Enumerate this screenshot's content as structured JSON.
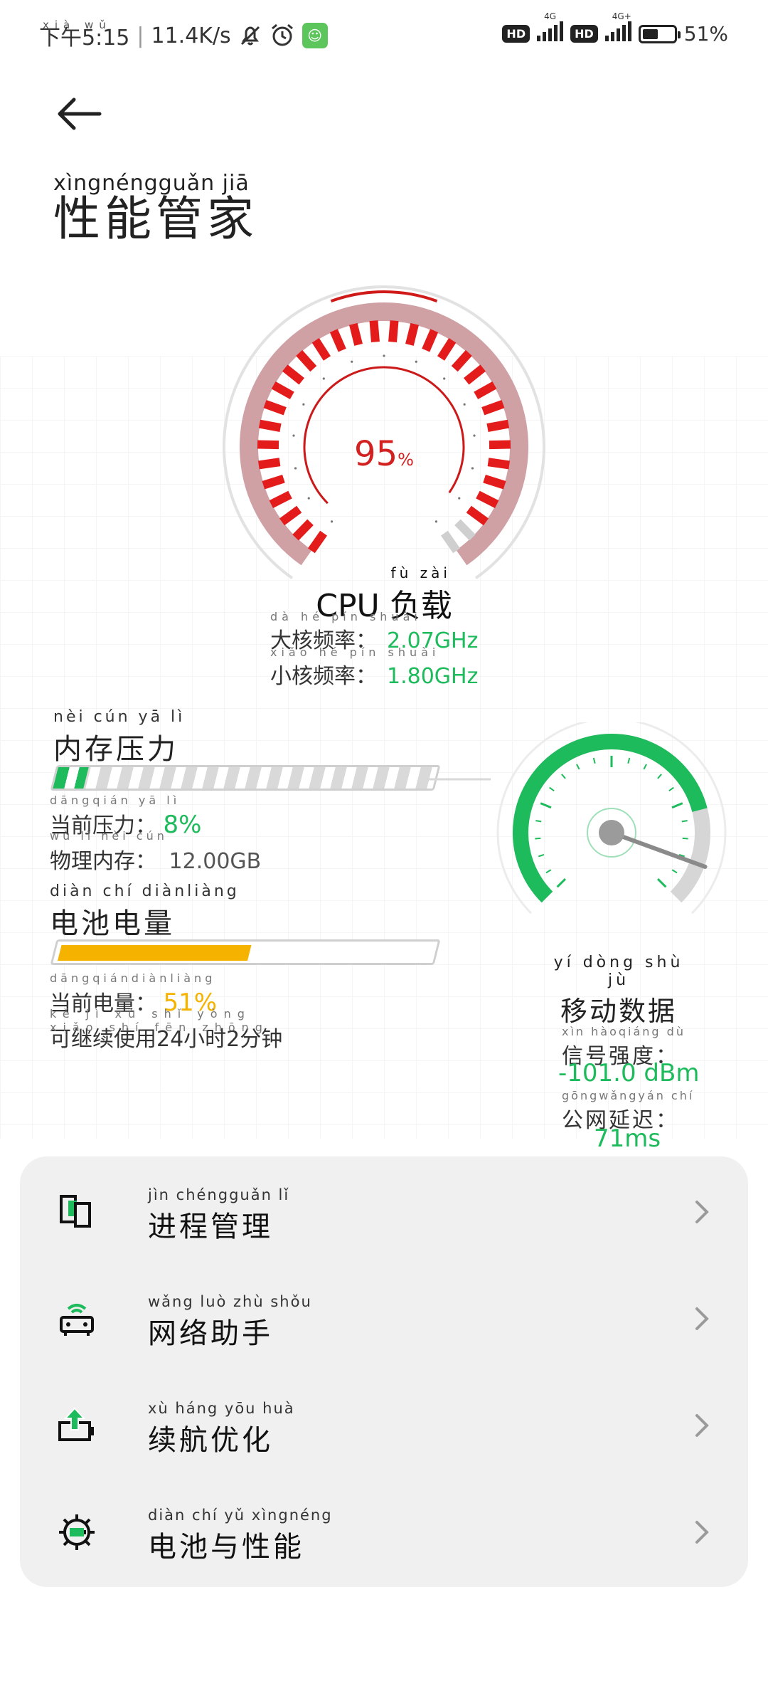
{
  "status_bar": {
    "time_pinyin": "xià wǔ",
    "time": "下午5:15",
    "speed": "11.4K/s",
    "network_1": "4G",
    "network_2": "4G+",
    "hd": "HD",
    "battery_percent": "51%",
    "battery_level": 0.51,
    "app_badge_icon": "cat-app-icon"
  },
  "header": {
    "back_icon": "arrow-left-icon",
    "title_pinyin": "xìngnéngguǎn jiā",
    "title": "性能管家"
  },
  "cpu": {
    "value": "95",
    "unit": "%",
    "load_fraction": 0.95,
    "label_prefix": "CPU",
    "label_pinyin": "fù zài",
    "label_suffix": "负载",
    "big_core_pinyin": "dà hé pín shuài",
    "big_core_label": "大核频率：",
    "big_core_value": "2.07GHz",
    "small_core_pinyin": "xiǎo hé pín shuài",
    "small_core_label": "小核频率：",
    "small_core_value": "1.80GHz"
  },
  "memory": {
    "title_pinyin": "nèi cún yā lì",
    "title": "内存压力",
    "pressure_fraction": 0.08,
    "current_pinyin": "dāngqián yā lì",
    "current_label": "当前压力：",
    "current_value": "8%",
    "physical_pinyin": "wù lǐ nèi cún",
    "physical_label": "物理内存：",
    "physical_value": "12.00GB"
  },
  "battery": {
    "title_pinyin": "diàn chí diànliàng",
    "title": "电池电量",
    "level_fraction": 0.51,
    "current_pinyin": "dāngqiándiànliàng",
    "current_label": "当前电量：",
    "current_value": "51%",
    "remaining_pinyin": "kě jì xù shǐ yòng xiǎo shí fēn zhōng",
    "remaining_text": "可继续使用24小时2分钟"
  },
  "mobile_data": {
    "title_pinyin": "yí dòng shù jù",
    "title": "移动数据",
    "signal_pinyin": "xìn hàoqiáng dù",
    "signal_label": "信号强度：",
    "signal_value": "-101.0 dBm",
    "latency_pinyin": "gōngwǎngyán chí",
    "latency_label": "公网延迟：",
    "latency_value": "71ms"
  },
  "menu": {
    "items": [
      {
        "pinyin": "jìn chéngguǎn lǐ",
        "label": "进程管理",
        "icon": "process-manager-icon"
      },
      {
        "pinyin": "wǎng luò zhù shǒu",
        "label": "网络助手",
        "icon": "router-wifi-icon"
      },
      {
        "pinyin": "xù háng yōu huà",
        "label": "续航优化",
        "icon": "battery-upload-icon"
      },
      {
        "pinyin": "diàn chí yǔ xìngnéng",
        "label": "电池与性能",
        "icon": "gear-battery-icon"
      }
    ]
  },
  "colors": {
    "cpu_red": "#e41b1b",
    "accent_green": "#1dbb5c",
    "battery_amber": "#f5b300"
  }
}
